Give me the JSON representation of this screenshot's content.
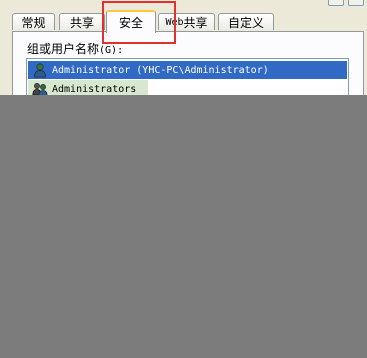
{
  "tabs": [
    {
      "label": "常规"
    },
    {
      "label": "共享"
    },
    {
      "label": "安全",
      "active": true
    },
    {
      "label_latin": "Web",
      "label_cjk": " 共享"
    },
    {
      "label": "自定义"
    }
  ],
  "group": {
    "label": "组或用户名称",
    "mnemonic": "(G):"
  },
  "users": [
    {
      "name": "Administrator (YHC-PC\\Administrator)",
      "icon": "user-icon",
      "selected": true
    },
    {
      "name": "Administrators",
      "icon": "group-icon",
      "selected": false
    }
  ],
  "colors": {
    "selection": "#316ac5",
    "highlight_box": "#e03030",
    "overlay": "#7c7c7c"
  }
}
